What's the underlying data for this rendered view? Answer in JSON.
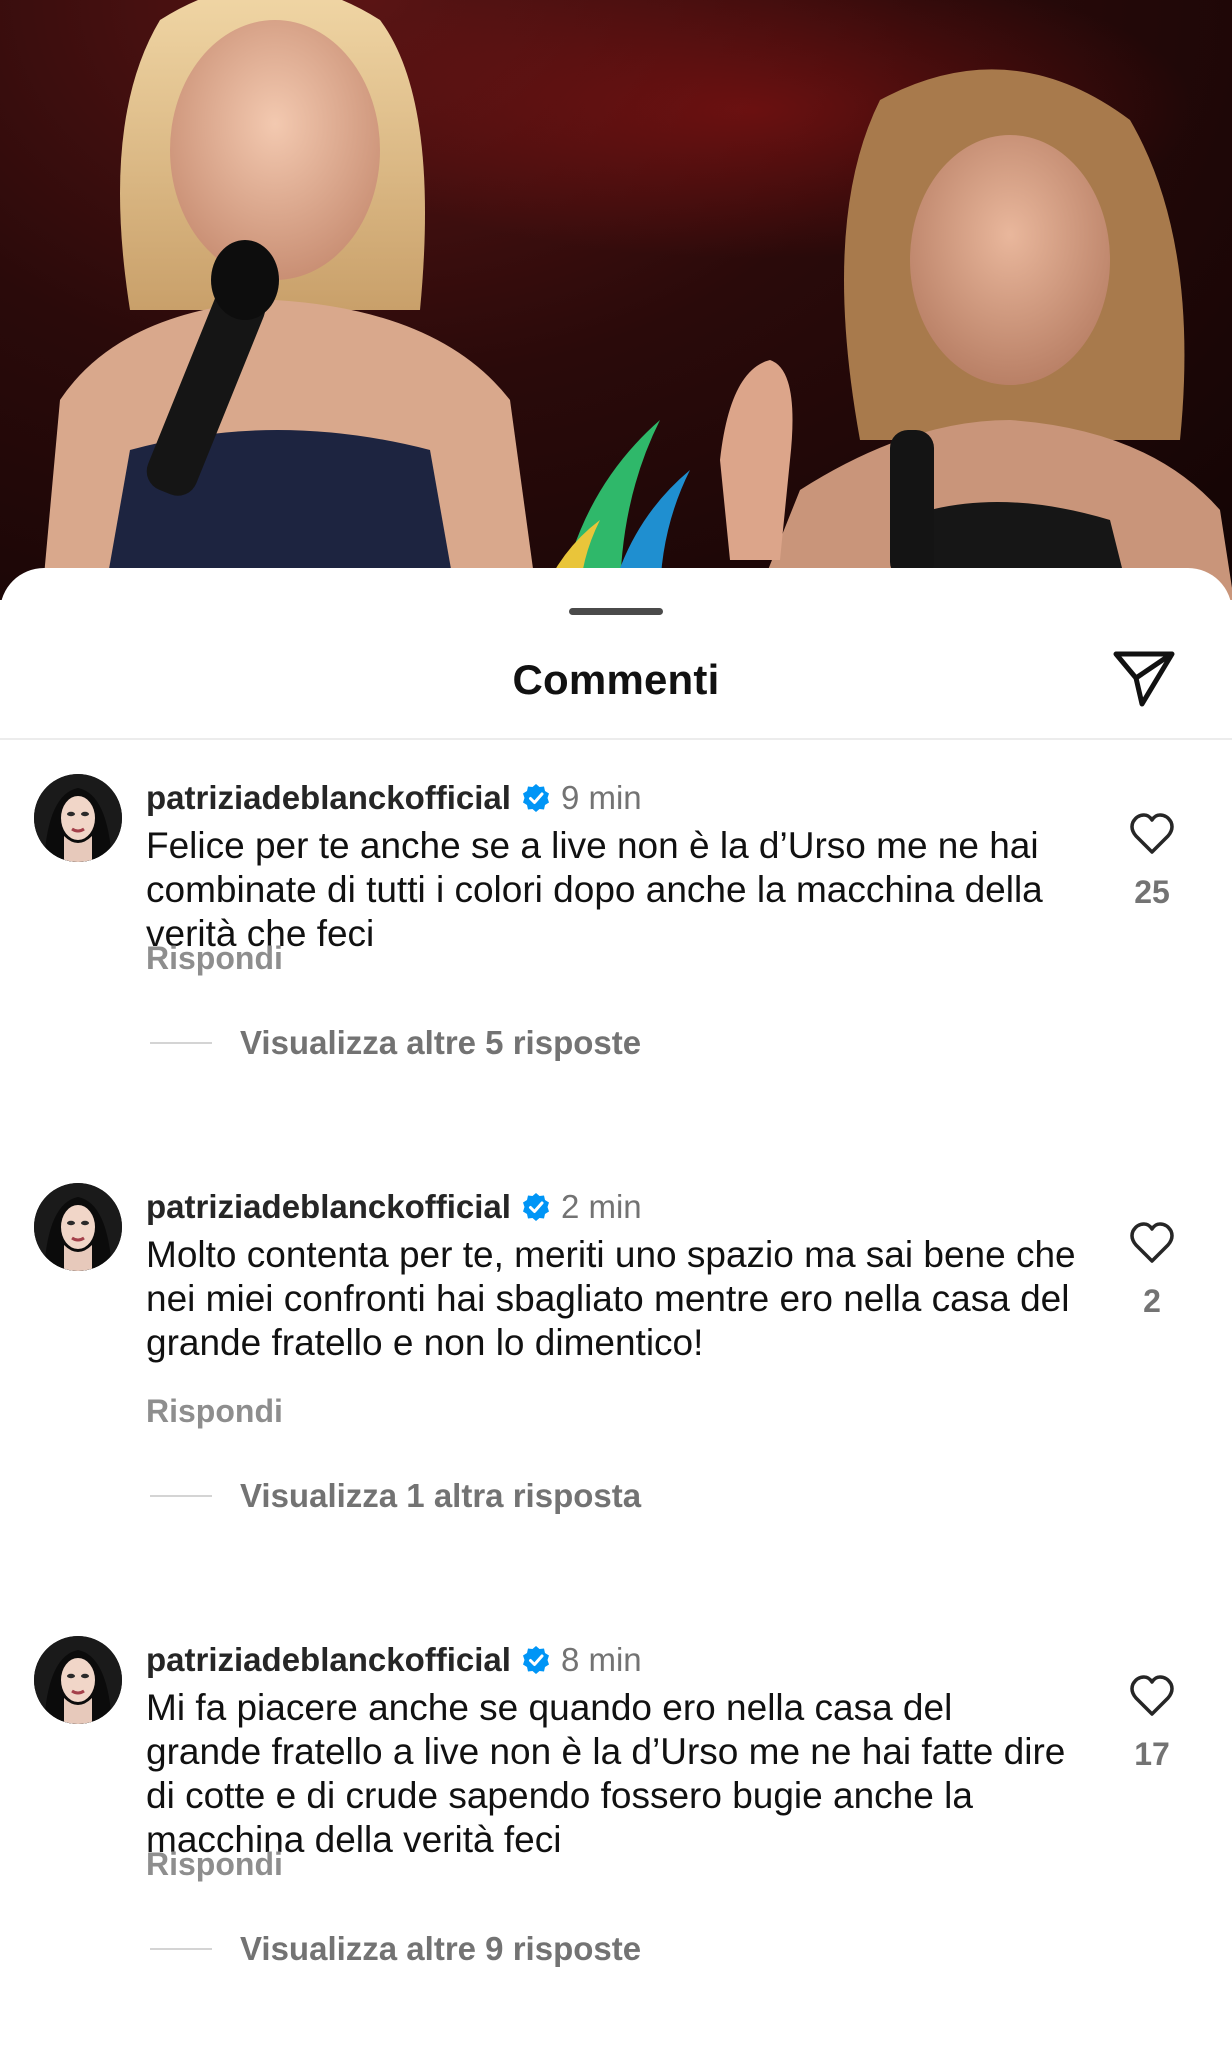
{
  "sheet": {
    "title": "Commenti",
    "share_icon": "paper-plane-icon"
  },
  "comments": [
    {
      "username": "patriziadeblanckofficial",
      "verified": true,
      "time": "9 min",
      "text": "Felice per te anche se a live non è la d’Urso me ne hai combinate di tutti i colori  dopo anche la macchina della verità che feci",
      "reply_label": "Rispondi",
      "view_replies": "Visualizza altre 5 risposte",
      "likes": "25"
    },
    {
      "username": "patriziadeblanckofficial",
      "verified": true,
      "time": "2 min",
      "text": "Molto contenta per te, meriti uno spazio ma sai bene che nei miei confronti hai sbagliato mentre ero nella casa del grande fratello e non lo dimentico!",
      "reply_label": "Rispondi",
      "view_replies": "Visualizza 1 altra risposta",
      "likes": "2"
    },
    {
      "username": "patriziadeblanckofficial",
      "verified": true,
      "time": "8 min",
      "text": "Mi fa piacere anche se quando ero nella casa del grande fratello a live non è la d’Urso me ne hai fatte dire di cotte e di crude sapendo fossero bugie anche la macchina della verità feci",
      "reply_label": "Rispondi",
      "view_replies": "Visualizza altre 9 risposte",
      "likes": "17"
    }
  ],
  "colors": {
    "verified_blue": "#0095f6",
    "secondary_text": "#737373",
    "primary_text": "#111111"
  },
  "icons": [
    "paper-plane-icon",
    "verified-badge-icon",
    "heart-icon"
  ]
}
